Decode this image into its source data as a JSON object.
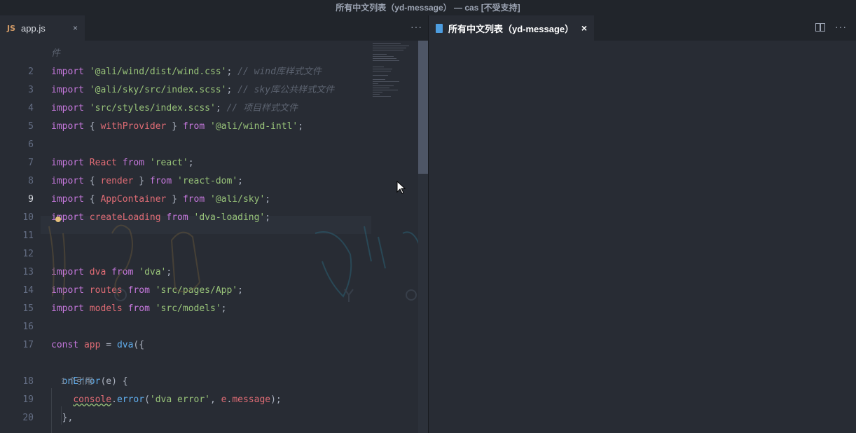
{
  "window": {
    "title": "所有中文列表（yd-message） — cas [不受支持]"
  },
  "left_editor": {
    "tab": {
      "icon_text": "JS",
      "label": "app.js",
      "close": "×"
    },
    "more_actions": "···",
    "code_lens": "1 个引用",
    "active_line": 9,
    "lines": [
      {
        "n": "",
        "tokens": [
          {
            "c": "cm",
            "t": "件"
          }
        ]
      },
      {
        "n": "2",
        "tokens": [
          {
            "c": "kw",
            "t": "import "
          },
          {
            "c": "str",
            "t": "'@ali/wind/dist/wind.css'"
          },
          {
            "c": "plain",
            "t": "; "
          },
          {
            "c": "cm",
            "t": "// wind库样式文件"
          }
        ]
      },
      {
        "n": "3",
        "tokens": [
          {
            "c": "kw",
            "t": "import "
          },
          {
            "c": "str",
            "t": "'@ali/sky/src/index.scss'"
          },
          {
            "c": "plain",
            "t": "; "
          },
          {
            "c": "cm",
            "t": "// sky库公共样式文件"
          }
        ]
      },
      {
        "n": "4",
        "tokens": [
          {
            "c": "kw",
            "t": "import "
          },
          {
            "c": "str",
            "t": "'src/styles/index.scss'"
          },
          {
            "c": "plain",
            "t": "; "
          },
          {
            "c": "cm",
            "t": "// 项目样式文件"
          }
        ]
      },
      {
        "n": "5",
        "tokens": [
          {
            "c": "kw",
            "t": "import "
          },
          {
            "c": "plain",
            "t": "{ "
          },
          {
            "c": "var",
            "t": "withProvider"
          },
          {
            "c": "plain",
            "t": " } "
          },
          {
            "c": "kw",
            "t": "from "
          },
          {
            "c": "str",
            "t": "'@ali/wind-intl'"
          },
          {
            "c": "plain",
            "t": ";"
          }
        ]
      },
      {
        "n": "6",
        "tokens": []
      },
      {
        "n": "7",
        "tokens": [
          {
            "c": "kw",
            "t": "import "
          },
          {
            "c": "var",
            "t": "React"
          },
          {
            "c": "kw",
            "t": " from "
          },
          {
            "c": "str",
            "t": "'react'"
          },
          {
            "c": "plain",
            "t": ";"
          }
        ]
      },
      {
        "n": "8",
        "tokens": [
          {
            "c": "kw",
            "t": "import "
          },
          {
            "c": "plain",
            "t": "{ "
          },
          {
            "c": "var",
            "t": "render"
          },
          {
            "c": "plain",
            "t": " } "
          },
          {
            "c": "kw",
            "t": "from "
          },
          {
            "c": "str",
            "t": "'react-dom'"
          },
          {
            "c": "plain",
            "t": ";"
          }
        ]
      },
      {
        "n": "9",
        "tokens": [
          {
            "c": "kw",
            "t": "import "
          },
          {
            "c": "plain",
            "t": "{ "
          },
          {
            "c": "var",
            "t": "AppContainer"
          },
          {
            "c": "plain",
            "t": " } "
          },
          {
            "c": "kw",
            "t": "from "
          },
          {
            "c": "str",
            "t": "'@ali/sky'"
          },
          {
            "c": "plain",
            "t": ";"
          }
        ]
      },
      {
        "n": "10",
        "tokens": [
          {
            "c": "kw",
            "t": "import "
          },
          {
            "c": "var",
            "t": "createLoading"
          },
          {
            "c": "kw",
            "t": " from "
          },
          {
            "c": "str",
            "t": "'dva-loading'"
          },
          {
            "c": "plain",
            "t": ";"
          }
        ]
      },
      {
        "n": "11",
        "tokens": []
      },
      {
        "n": "12",
        "tokens": []
      },
      {
        "n": "13",
        "tokens": [
          {
            "c": "kw",
            "t": "import "
          },
          {
            "c": "var",
            "t": "dva"
          },
          {
            "c": "kw",
            "t": " from "
          },
          {
            "c": "str",
            "t": "'dva'"
          },
          {
            "c": "plain",
            "t": ";"
          }
        ]
      },
      {
        "n": "14",
        "tokens": [
          {
            "c": "kw",
            "t": "import "
          },
          {
            "c": "var",
            "t": "routes"
          },
          {
            "c": "kw",
            "t": " from "
          },
          {
            "c": "str",
            "t": "'src/pages/App'"
          },
          {
            "c": "plain",
            "t": ";"
          }
        ]
      },
      {
        "n": "15",
        "tokens": [
          {
            "c": "kw",
            "t": "import "
          },
          {
            "c": "var",
            "t": "models"
          },
          {
            "c": "kw",
            "t": " from "
          },
          {
            "c": "str",
            "t": "'src/models'"
          },
          {
            "c": "plain",
            "t": ";"
          }
        ]
      },
      {
        "n": "16",
        "tokens": []
      },
      {
        "n": "17",
        "tokens": [
          {
            "c": "kw",
            "t": "const "
          },
          {
            "c": "var",
            "t": "app"
          },
          {
            "c": "plain",
            "t": " = "
          },
          {
            "c": "fn",
            "t": "dva"
          },
          {
            "c": "plain",
            "t": "({"
          }
        ]
      },
      {
        "n": "",
        "tokens": []
      },
      {
        "n": "18",
        "tokens": [
          {
            "c": "plain",
            "t": "  "
          },
          {
            "c": "fn",
            "t": "onError"
          },
          {
            "c": "plain",
            "t": "(e) {"
          }
        ]
      },
      {
        "n": "19",
        "tokens": [
          {
            "c": "plain",
            "t": "    "
          },
          {
            "c": "var squiggle",
            "t": "console"
          },
          {
            "c": "plain",
            "t": "."
          },
          {
            "c": "fn",
            "t": "error"
          },
          {
            "c": "plain",
            "t": "("
          },
          {
            "c": "str",
            "t": "'dva error'"
          },
          {
            "c": "plain",
            "t": ", "
          },
          {
            "c": "var",
            "t": "e"
          },
          {
            "c": "plain",
            "t": "."
          },
          {
            "c": "var",
            "t": "message"
          },
          {
            "c": "plain",
            "t": ");"
          }
        ]
      },
      {
        "n": "20",
        "tokens": [
          {
            "c": "plain",
            "t": "  },"
          }
        ]
      }
    ]
  },
  "right_editor": {
    "tab": {
      "label": "所有中文列表（yd-message）",
      "close": "×"
    },
    "more_actions": "···"
  }
}
